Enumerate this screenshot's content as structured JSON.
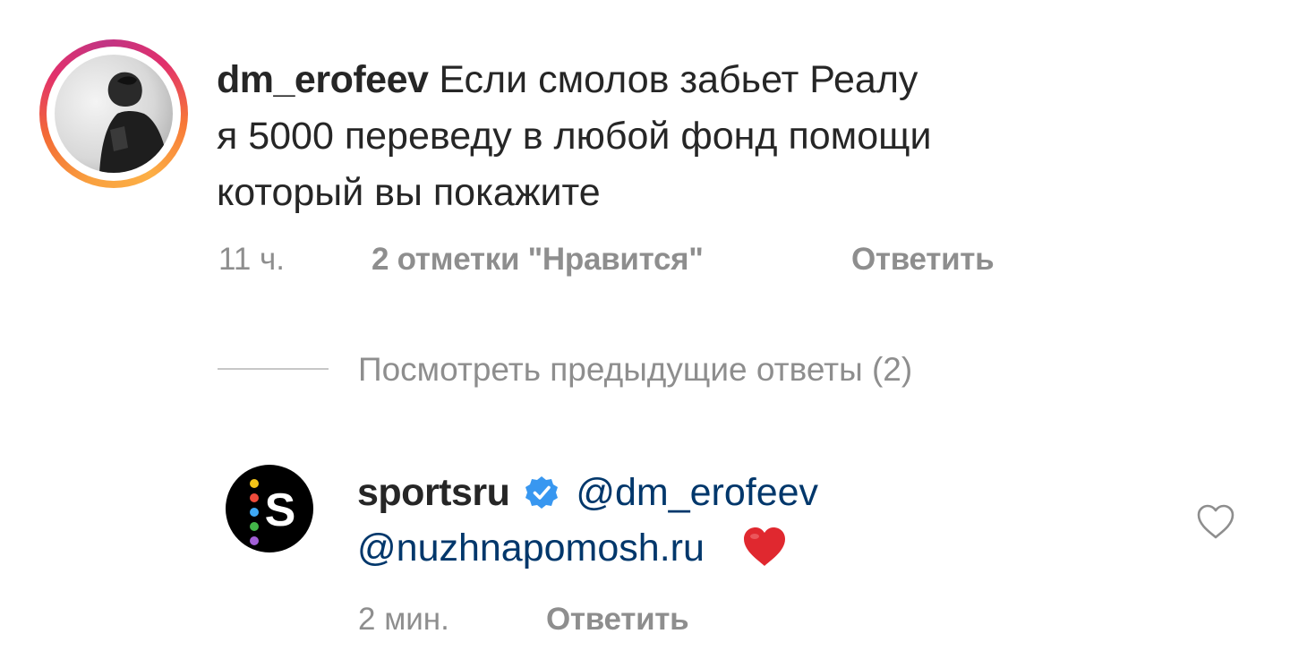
{
  "comment": {
    "username": "dm_erofeev",
    "text_line1": "Если смолов забьет Реалу",
    "text_line2": "я 5000 переведу в любой фонд помощи",
    "text_line3": "который вы покажите",
    "time": "11 ч.",
    "likes": "2 отметки \"Нравится\"",
    "reply_label": "Ответить"
  },
  "view_replies": "Посмотреть предыдущие ответы (2)",
  "reply": {
    "username": "sportsru",
    "verified_icon": "verified-badge-icon",
    "mention1": "@dm_erofeev",
    "mention2": "@nuzhnapomosh.ru",
    "emoji": "❤️",
    "time": "2 мин.",
    "reply_label": "Ответить",
    "like_icon": "heart-outline-icon"
  },
  "colors": {
    "text": "#262626",
    "meta": "#8e8e8e",
    "mention": "#00376b",
    "verified": "#3897f0",
    "heart": "#e0282f"
  }
}
